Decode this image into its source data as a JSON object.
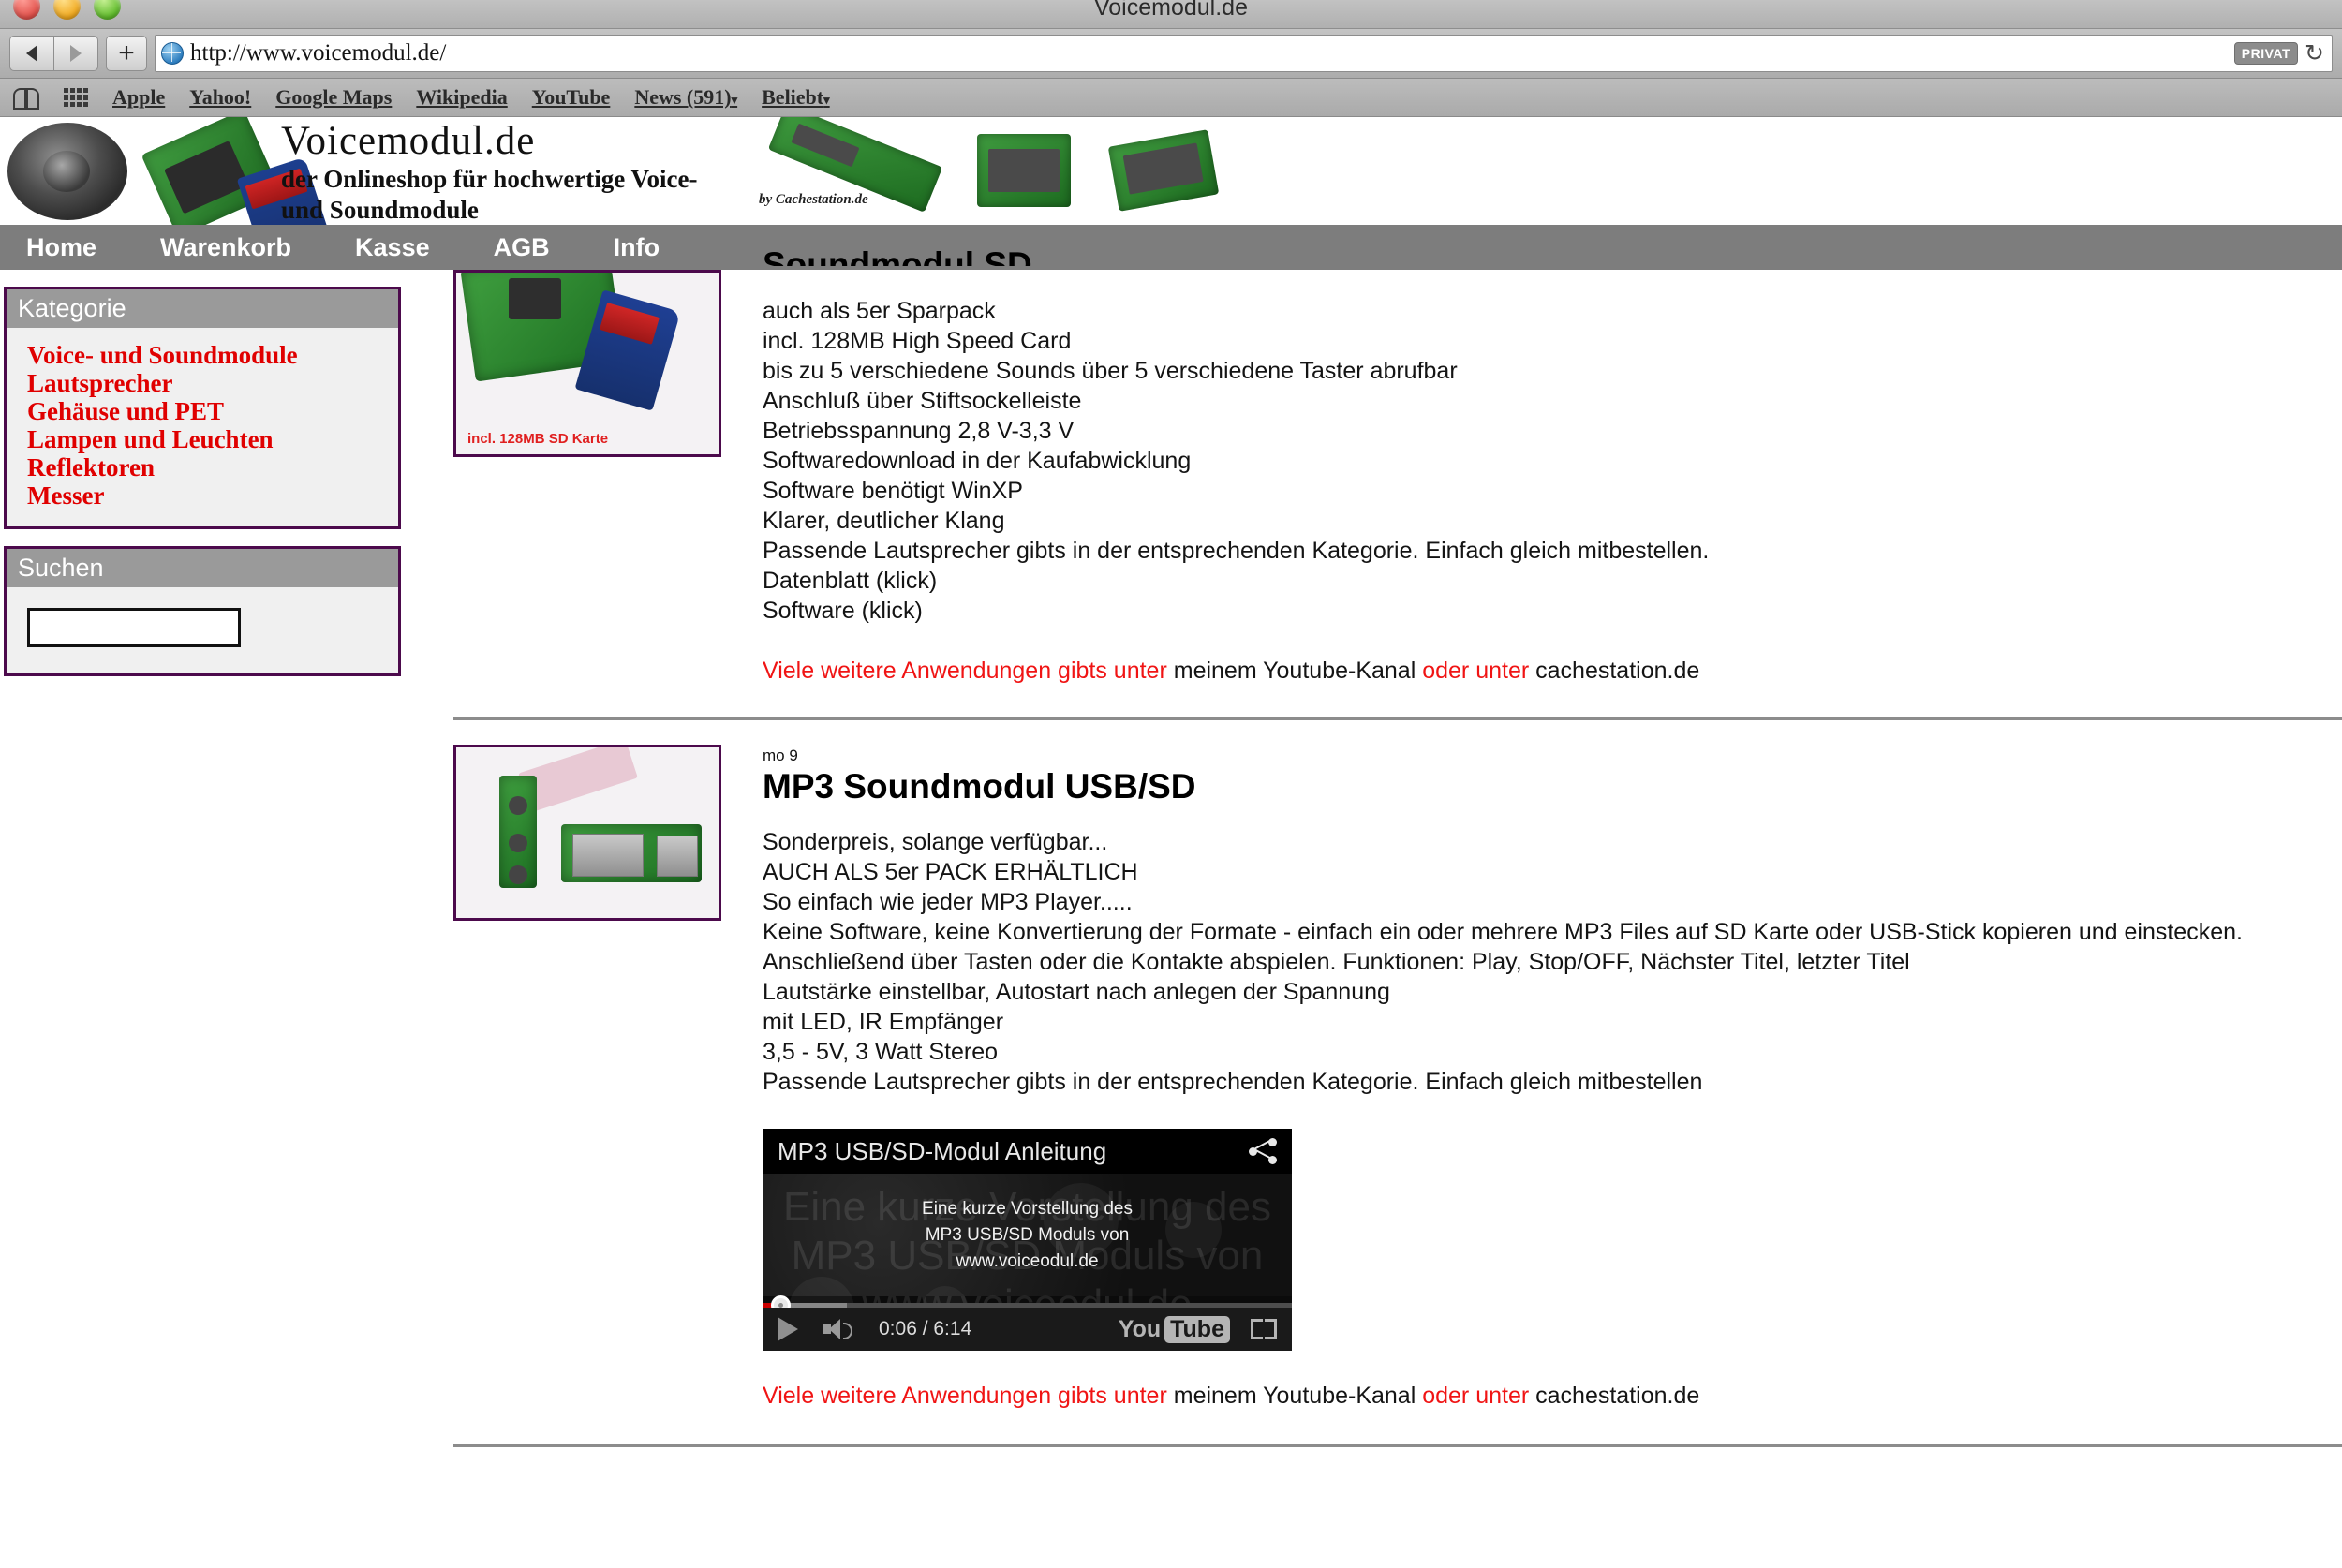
{
  "browser": {
    "window_title": "Voicemodul.de",
    "url": "http://www.voicemodul.de/",
    "privacy_badge": "PRIVAT",
    "back_icon": "back-arrow-icon",
    "forward_icon": "forward-arrow-icon",
    "new_tab_icon": "plus-icon",
    "site_icon": "globe-icon",
    "reload_icon": "reload-icon",
    "bookmarks": [
      {
        "label": "Apple",
        "has_caret": false
      },
      {
        "label": "Yahoo!",
        "has_caret": false
      },
      {
        "label": "Google Maps",
        "has_caret": false
      },
      {
        "label": "Wikipedia",
        "has_caret": false
      },
      {
        "label": "YouTube",
        "has_caret": false
      },
      {
        "label": "News (591)",
        "has_caret": true
      },
      {
        "label": "Beliebt",
        "has_caret": true
      }
    ],
    "caret_glyph": "▾"
  },
  "site": {
    "logo_title": "Voicemodul.de",
    "logo_sub_line1": "der Onlineshop für hochwertige Voice-",
    "logo_sub_line2": "und Soundmodule",
    "logo_by": "by Cachestation.de",
    "nav": [
      {
        "label": "Home"
      },
      {
        "label": "Warenkorb"
      },
      {
        "label": "Kasse"
      },
      {
        "label": "AGB"
      },
      {
        "label": "Info"
      }
    ]
  },
  "sidebar": {
    "category_panel": {
      "title": "Kategorie",
      "items": [
        {
          "label": "Voice- und Soundmodule"
        },
        {
          "label": "Lautsprecher"
        },
        {
          "label": "Gehäuse und PET"
        },
        {
          "label": "Lampen und Leuchten"
        },
        {
          "label": "Reflektoren"
        },
        {
          "label": "Messer"
        }
      ]
    },
    "search_panel": {
      "title": "Suchen",
      "input_value": "",
      "input_placeholder": ""
    }
  },
  "products": [
    {
      "article_no": "",
      "title": "Soundmodul SD",
      "image_caption": "incl. 128MB SD Karte",
      "specs": [
        {
          "text": "auch als 5er Sparpack",
          "style": "normal"
        },
        {
          "text": "incl. 128MB High Speed Card",
          "style": "normal"
        },
        {
          "text": "bis zu 5 verschiedene Sounds über 5 verschiedene Taster abrufbar",
          "style": "normal"
        },
        {
          "text": "Anschluß über Stiftsockelleiste",
          "style": "normal"
        },
        {
          "text": "Betriebsspannung 2,8 V-3,3 V",
          "style": "normal"
        },
        {
          "text": "Softwaredownload in der Kaufabwicklung",
          "style": "normal"
        },
        {
          "text": "Software benötigt WinXP",
          "style": "normal"
        },
        {
          "text": "Klarer, deutlicher Klang",
          "style": "normal"
        },
        {
          "text": "Passende Lautsprecher gibts in der entsprechenden Kategorie. Einfach gleich mitbestellen.",
          "style": "normal"
        },
        {
          "text": "Datenblatt (klick)",
          "style": "bold"
        },
        {
          "text": "Software (klick)",
          "style": "bold"
        }
      ]
    },
    {
      "article_no": "mo 9",
      "title": "MP3 Soundmodul USB/SD",
      "image_caption": "",
      "specs": [
        {
          "text": "Sonderpreis, solange verfügbar...",
          "style": "red"
        },
        {
          "text": "AUCH ALS 5er PACK ERHÄLTLICH",
          "style": "normal"
        },
        {
          "text": "So einfach wie jeder MP3 Player.....",
          "style": "normal"
        },
        {
          "text": "Keine Software, keine Konvertierung der Formate - einfach ein oder mehrere MP3 Files auf SD Karte oder USB-Stick kopieren und einstecken.",
          "style": "normal"
        },
        {
          "text": "Anschließend über Tasten oder die Kontakte abspielen. Funktionen: Play, Stop/OFF, Nächster Titel, letzter Titel",
          "style": "normal"
        },
        {
          "text": "Lautstärke einstellbar, Autostart nach anlegen der Spannung",
          "style": "normal"
        },
        {
          "text": "mit LED, IR Empfänger",
          "style": "normal"
        },
        {
          "text": "3,5 - 5V, 3 Watt Stereo",
          "style": "normal"
        },
        {
          "text": "Passende Lautsprecher gibts in der entsprechenden Kategorie. Einfach gleich mitbestellen",
          "style": "normal"
        }
      ]
    }
  ],
  "footer_link": {
    "part1": "Viele weitere Anwendungen gibts unter",
    "part2": " meinem Youtube-Kanal ",
    "part3": "oder unter",
    "part4": " cachestation.de"
  },
  "video": {
    "title": "MP3 USB/SD-Modul Anleitung",
    "share_icon": "share-icon",
    "play_icon": "play-icon",
    "volume_icon": "volume-icon",
    "fullscreen_icon": "fullscreen-icon",
    "brand_you": "You",
    "brand_tube": "Tube",
    "current_time": "0:06",
    "separator": " / ",
    "duration": "6:14",
    "time_display": "0:06 / 6:14",
    "caption_line1": "Eine kurze Vorstellung des",
    "caption_line2": "MP3 USB/SD Moduls von",
    "caption_line3": "www.voiceodul.de"
  },
  "colors": {
    "accent_red": "#e00000",
    "panel_border": "#4c0a4c",
    "nav_bar": "#7d7d7d",
    "panel_head": "#9a9a9a",
    "youtube_red": "#cc0000"
  }
}
